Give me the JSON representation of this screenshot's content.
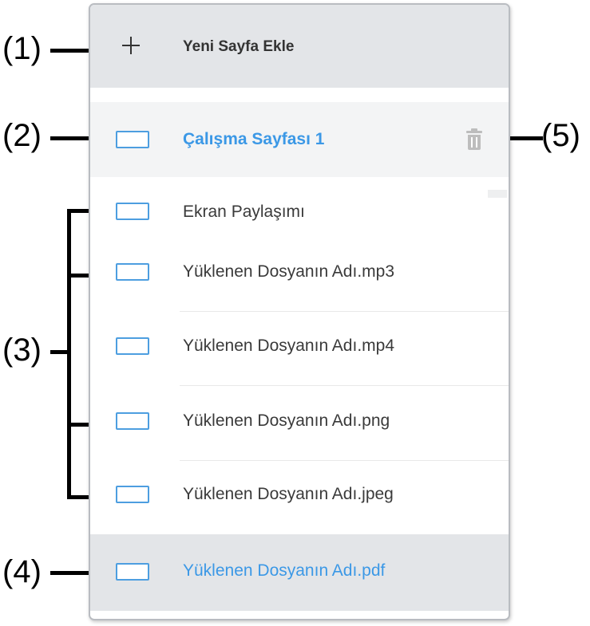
{
  "annotations": {
    "c1": "(1)",
    "c2": "(2)",
    "c3": "(3)",
    "c4": "(4)",
    "c5": "(5)"
  },
  "panel": {
    "add_page_label": "Yeni Sayfa Ekle",
    "active_page": {
      "label": "Çalışma Sayfası 1",
      "delete_icon": "trash-icon"
    },
    "items": [
      {
        "label": "Ekran Paylaşımı"
      },
      {
        "label": "Yüklenen Dosyanın Adı.mp3"
      },
      {
        "label": "Yüklenen Dosyanın Adı.mp4"
      },
      {
        "label": "Yüklenen Dosyanın Adı.png"
      },
      {
        "label": "Yüklenen Dosyanın Adı.jpeg"
      }
    ],
    "selected_item": {
      "label": "Yüklenen Dosyanın Adı.pdf"
    }
  },
  "colors": {
    "accent": "#3b98e6",
    "header_bg": "#e3e5e8",
    "thumbnail_border": "#4d9ee0"
  }
}
